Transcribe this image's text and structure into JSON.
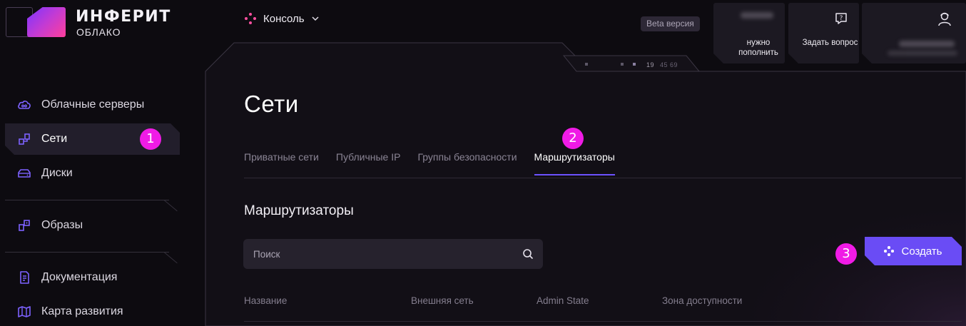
{
  "brand": {
    "name": "ИНФЕРИТ",
    "sub": "ОБЛАКО"
  },
  "topbar": {
    "console_label": "Консоль",
    "beta_badge": "Beta версия",
    "balance_card": {
      "label": "нужно пополнить"
    },
    "question_card": {
      "label": "Задать вопрос"
    },
    "profile_card": {}
  },
  "timeline": {
    "num1": "19",
    "num2": "45 69"
  },
  "sidebar": {
    "items": [
      {
        "label": "Облачные серверы",
        "icon": "cloud-server-icon"
      },
      {
        "label": "Сети",
        "icon": "network-icon",
        "active": true
      },
      {
        "label": "Диски",
        "icon": "disk-icon"
      },
      {
        "label": "Образы",
        "icon": "images-icon"
      },
      {
        "label": "Документация",
        "icon": "document-icon"
      },
      {
        "label": "Карта развития",
        "icon": "map-icon"
      }
    ]
  },
  "annotations": {
    "b1": "1",
    "b2": "2",
    "b3": "3"
  },
  "page": {
    "title": "Сети",
    "tabs": [
      {
        "label": "Приватные сети"
      },
      {
        "label": "Публичные IP"
      },
      {
        "label": "Группы безопасности"
      },
      {
        "label": "Маршрутизаторы",
        "active": true
      }
    ],
    "section_title": "Маршрутизаторы",
    "search_placeholder": "Поиск",
    "create_label": "Создать",
    "table_headers": [
      "Название",
      "Внешняя сеть",
      "Admin State",
      "Зона доступности"
    ]
  },
  "colors": {
    "accent": "#6a4cf5",
    "annotation": "#f01be6",
    "background": "#0d0b10",
    "active_nav": "#221e2b"
  }
}
